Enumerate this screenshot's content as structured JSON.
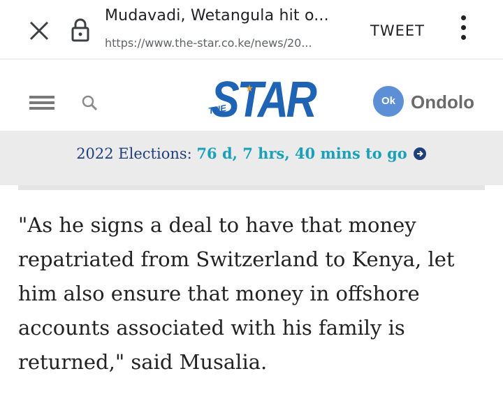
{
  "browser": {
    "title": "Mudavadi, Wetangula hit o...",
    "url": "https://www.the-star.co.ke/news/20...",
    "tweet_label": "TWEET",
    "icons": [
      "close-icon",
      "lock-icon",
      "more-vert-icon"
    ]
  },
  "site": {
    "logo_text": "STAR",
    "logo_small": "THE",
    "user_initials": "Ok",
    "user_name": "Ondolo",
    "brand_color": "#1f63b5"
  },
  "banner": {
    "label": "2022 Elections: ",
    "countdown": "76 d, 7 hrs, 40 mins to go"
  },
  "article": {
    "paragraph": "\"As he signs a deal to have that money repatriated from Switzerland to Kenya, let him also ensure that money in offshore accounts associated with his family is returned,\" said Musalia."
  }
}
